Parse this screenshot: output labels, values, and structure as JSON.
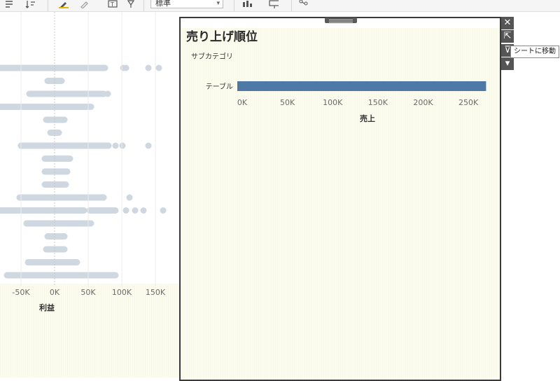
{
  "toolbar": {
    "view_select": "標準",
    "icons": [
      "swap-rows-icon",
      "sort-icon",
      "highlight-icon",
      "annotate-icon",
      "label-icon",
      "pin-icon",
      "show-me-icon",
      "presentation-icon",
      "share-icon"
    ]
  },
  "background_sheet": {
    "x_ticks": [
      "-50K",
      "0K",
      "50K",
      "100K",
      "150K"
    ],
    "x_title": "利益"
  },
  "popup": {
    "title": "売り上げ順位",
    "chart_data": {
      "type": "bar",
      "orientation": "horizontal",
      "row_header": "サブカテゴリ",
      "categories": [
        "テーブル"
      ],
      "values": [
        275000
      ],
      "xlabel": "売上",
      "x_ticks": [
        "0K",
        "50K",
        "100K",
        "150K",
        "200K",
        "250K"
      ],
      "xlim": [
        0,
        280000
      ],
      "bar_color": "#4e79a7"
    }
  },
  "side_buttons": {
    "close": "✕",
    "open": "⇱",
    "filter": "⊽",
    "more": "▾"
  },
  "tooltip": "シートに移動"
}
